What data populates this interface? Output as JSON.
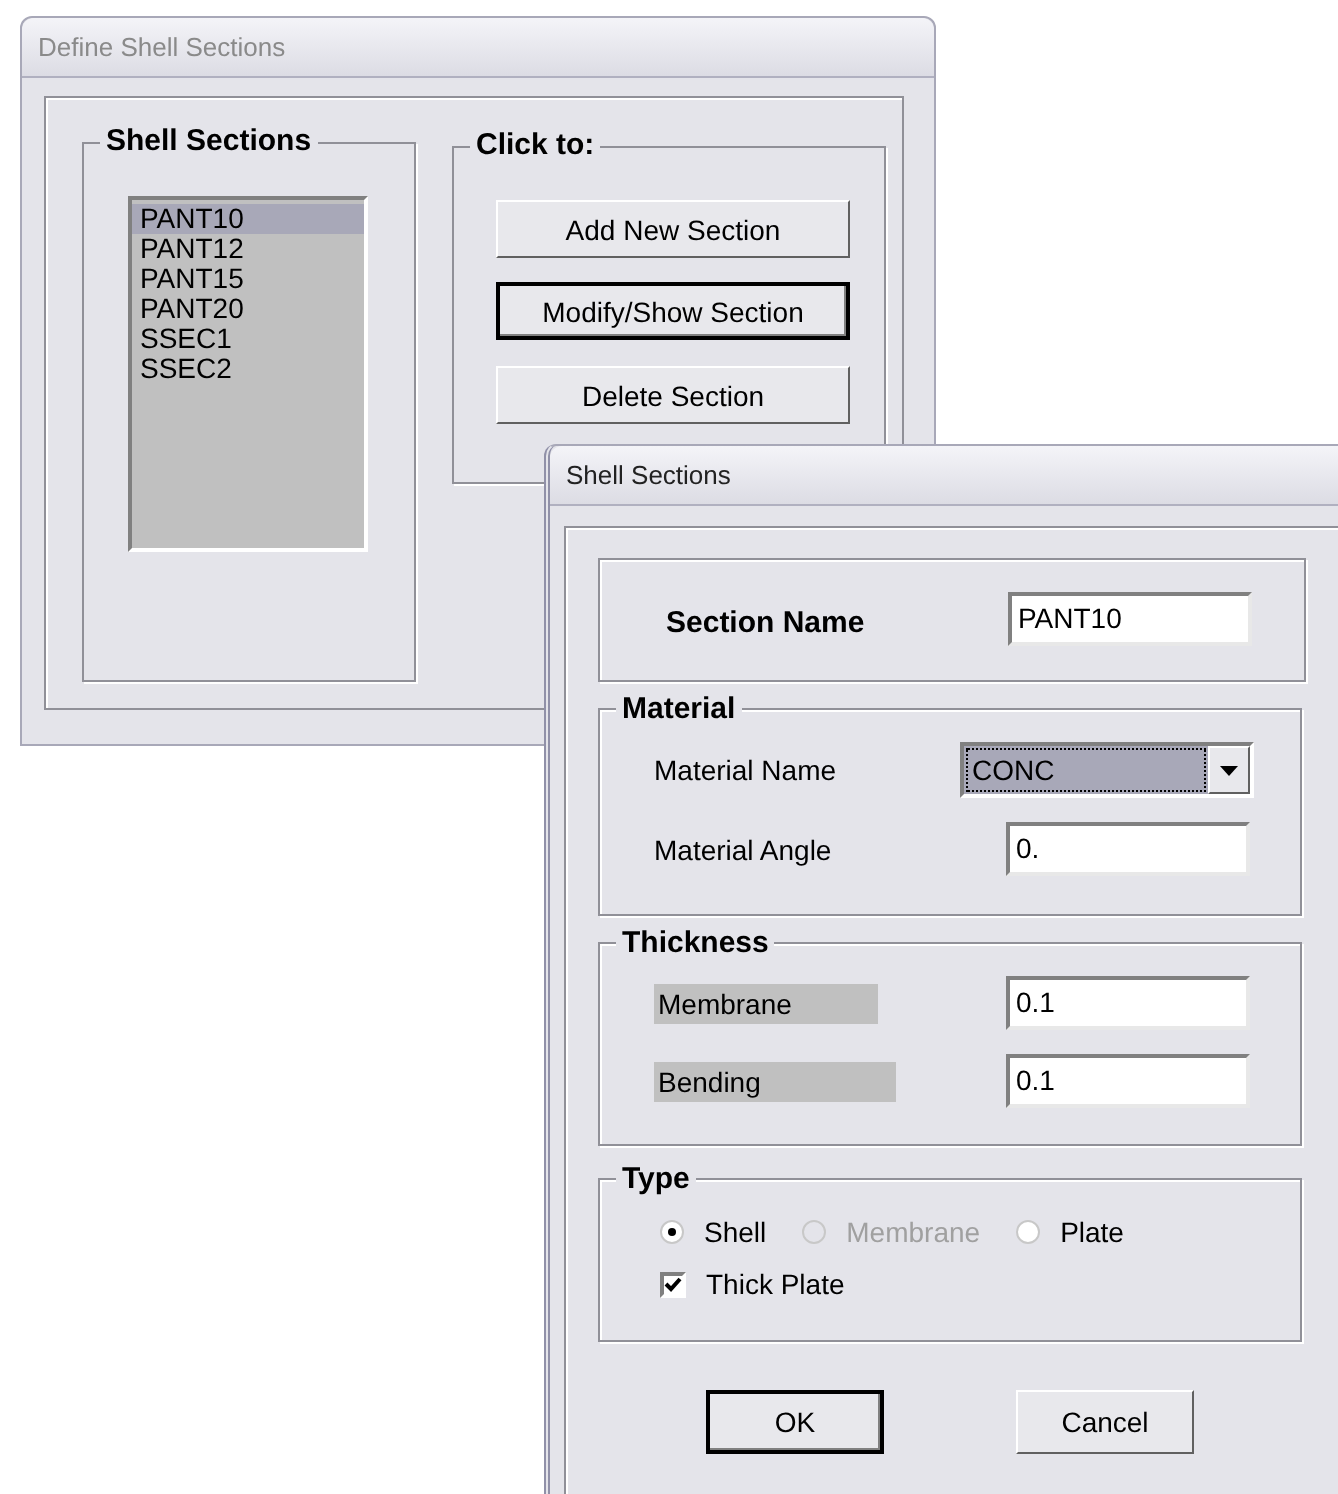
{
  "define_window": {
    "title": "Define Shell Sections",
    "sections_group": {
      "title": "Shell Sections",
      "items": [
        {
          "label": "PANT10",
          "selected": true
        },
        {
          "label": "PANT12",
          "selected": false
        },
        {
          "label": "PANT15",
          "selected": false
        },
        {
          "label": "PANT20",
          "selected": false
        },
        {
          "label": "SSEC1",
          "selected": false
        },
        {
          "label": "SSEC2",
          "selected": false
        }
      ]
    },
    "actions_group": {
      "title": "Click to:",
      "buttons": [
        {
          "label": "Add New Section",
          "default": false
        },
        {
          "label": "Modify/Show Section",
          "default": true
        },
        {
          "label": "Delete Section",
          "default": false
        }
      ]
    }
  },
  "section_window": {
    "title": "Shell Sections",
    "section_name": {
      "label": "Section Name",
      "value": "PANT10"
    },
    "material": {
      "title": "Material",
      "name_label": "Material Name",
      "name_value": "CONC",
      "angle_label": "Material Angle",
      "angle_value": "0."
    },
    "thickness": {
      "title": "Thickness",
      "membrane_label": "Membrane",
      "membrane_value": "0.1",
      "bending_label": "Bending",
      "bending_value": "0.1"
    },
    "type": {
      "title": "Type",
      "options": [
        {
          "label": "Shell",
          "selected": true,
          "disabled": false
        },
        {
          "label": "Membrane",
          "selected": false,
          "disabled": true
        },
        {
          "label": "Plate",
          "selected": false,
          "disabled": false
        }
      ],
      "thick_plate": {
        "label": "Thick Plate",
        "checked": true
      }
    },
    "buttons": [
      {
        "label": "OK",
        "default": true
      },
      {
        "label": "Cancel",
        "default": false
      }
    ]
  }
}
